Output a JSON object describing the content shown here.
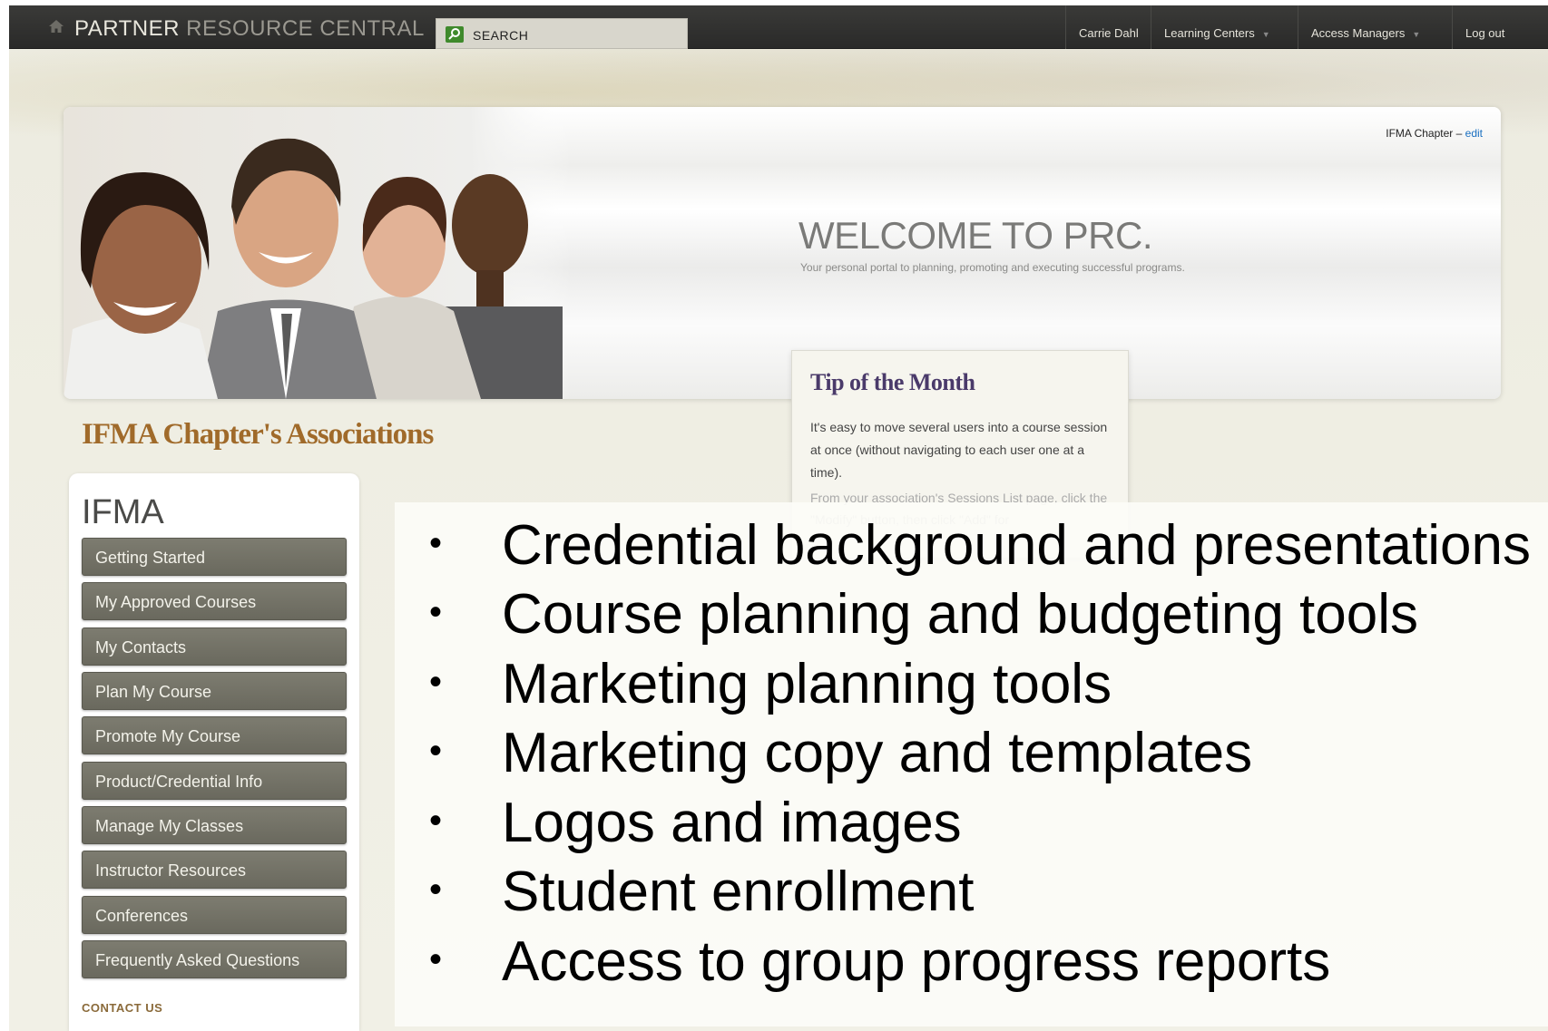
{
  "topbar": {
    "title_main": "PARTNER",
    "title_light": "RESOURCE CENTRAL",
    "search_label": "SEARCH",
    "nav": [
      {
        "label": "Carrie Dahl",
        "has_caret": false
      },
      {
        "label": "Learning Centers",
        "has_caret": true
      },
      {
        "label": "Access Managers",
        "has_caret": true
      },
      {
        "label": "Log out",
        "has_caret": false
      }
    ]
  },
  "banner": {
    "chapter_label": "IFMA Chapter –",
    "chapter_edit": "edit",
    "welcome_title": "WELCOME TO PRC.",
    "welcome_sub": "Your personal portal to planning, promoting and executing successful programs."
  },
  "tip": {
    "title": "Tip of the Month",
    "body": "It's easy to move several users into a course session at once (without navigating to each user one at a time).",
    "more": "From your association's Sessions List page, click the \"Modify\" button, then click \"Add\" for"
  },
  "associations_heading": "IFMA Chapter's Associations",
  "sidebar": {
    "title": "IFMA",
    "items": [
      "Getting Started",
      "My Approved Courses",
      "My Contacts",
      "Plan My Course",
      "Promote My Course",
      "Product/Credential Info",
      "Manage My Classes",
      "Instructor Resources",
      "Conferences",
      "Frequently Asked Questions"
    ],
    "contact": "CONTACT US"
  },
  "bullets": {
    "marker": "•",
    "items": [
      "Credential background and presentations",
      "Course planning and budgeting tools",
      "Marketing planning tools",
      "Marketing copy and templates",
      "Logos and images",
      "Student enrollment",
      "Access to group progress reports"
    ]
  },
  "icons": {
    "home": "home-icon",
    "search": "search-icon"
  }
}
